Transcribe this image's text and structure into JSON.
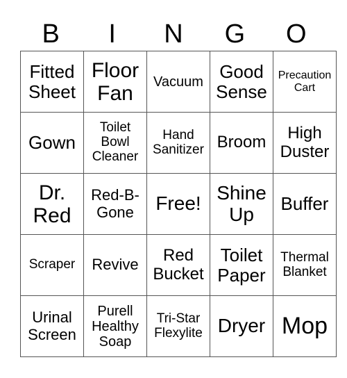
{
  "header": [
    "B",
    "I",
    "N",
    "G",
    "O"
  ],
  "rows": [
    [
      "Fitted Sheet",
      "Floor Fan",
      "Vacuum",
      "Good Sense",
      "Precaution Cart"
    ],
    [
      "Gown",
      "Toilet Bowl Cleaner",
      "Hand Sanitizer",
      "Broom",
      "High Duster"
    ],
    [
      "Dr. Red",
      "Red-B-Gone",
      "Free!",
      "Shine Up",
      "Buffer"
    ],
    [
      "Scraper",
      "Revive",
      "Red Bucket",
      "Toilet Paper",
      "Thermal Blanket"
    ],
    [
      "Urinal Screen",
      "Purell Healthy Soap",
      "Tri-Star Flexylite",
      "Dryer",
      "Mop"
    ]
  ]
}
